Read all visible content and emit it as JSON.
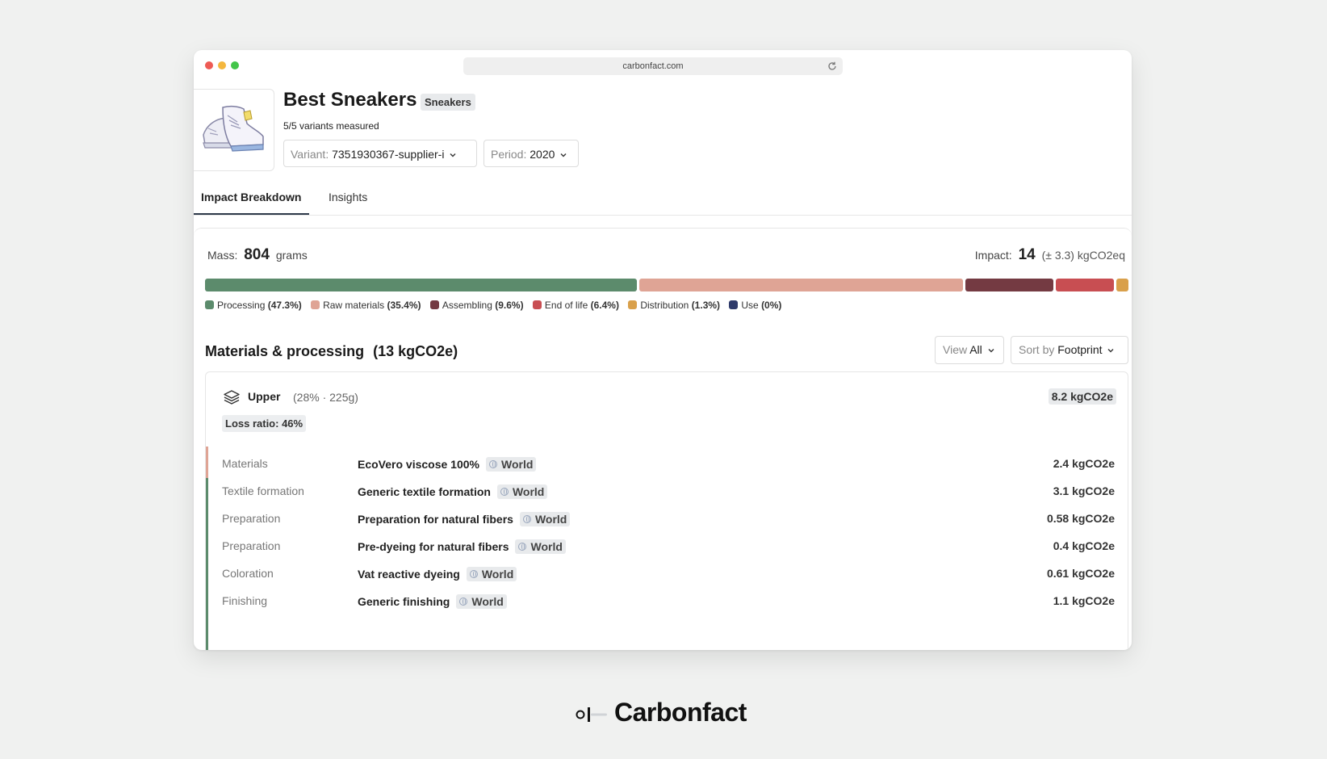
{
  "browser": {
    "url": "carbonfact.com"
  },
  "product": {
    "name": "Best Sneakers",
    "category": "Sneakers",
    "variants_measured": "5/5 variants measured",
    "variant_label": "Variant:",
    "variant_value": "7351930367-supplier-i",
    "period_label": "Period:",
    "period_value": "2020"
  },
  "tabs": [
    {
      "label": "Impact Breakdown",
      "active": true
    },
    {
      "label": "Insights",
      "active": false
    }
  ],
  "summary": {
    "mass_label": "Mass:",
    "mass_value": "804",
    "mass_unit": "grams",
    "impact_label": "Impact:",
    "impact_value": "14",
    "impact_range": "(± 3.3) kgCO2eq"
  },
  "breakdown": [
    {
      "name": "Processing",
      "pct_label": "(47.3%)",
      "pct": 47.3,
      "color": "#5c8b6c"
    },
    {
      "name": "Raw materials",
      "pct_label": "(35.4%)",
      "pct": 35.4,
      "color": "#dfa495"
    },
    {
      "name": "Assembling",
      "pct_label": "(9.6%)",
      "pct": 9.6,
      "color": "#743a42"
    },
    {
      "name": "End of life",
      "pct_label": "(6.4%)",
      "pct": 6.4,
      "color": "#c84e52"
    },
    {
      "name": "Distribution",
      "pct_label": "(1.3%)",
      "pct": 1.3,
      "color": "#d9a04b"
    },
    {
      "name": "Use",
      "pct_label": "(0%)",
      "pct": 0,
      "color": "#2e3a6a"
    }
  ],
  "materials_section": {
    "title": "Materials & processing",
    "total": "(13 kgCO2e)",
    "view_label": "View",
    "view_value": "All",
    "sort_label": "Sort by",
    "sort_value": "Footprint"
  },
  "component": {
    "name": "Upper",
    "meta": "(28% · 225g)",
    "total": "8.2 kgCO2e",
    "loss_ratio": "Loss ratio: 46%",
    "rows": [
      {
        "stage": "Materials",
        "process": "EcoVero viscose 100%",
        "location": "World",
        "value": "2.4 kgCO2e"
      },
      {
        "stage": "Textile formation",
        "process": "Generic textile formation",
        "location": "World",
        "value": "3.1 kgCO2e"
      },
      {
        "stage": "Preparation",
        "process": "Preparation for natural fibers",
        "location": "World",
        "value": "0.58 kgCO2e"
      },
      {
        "stage": "Preparation",
        "process": "Pre-dyeing for natural fibers",
        "location": "World",
        "value": "0.4 kgCO2e"
      },
      {
        "stage": "Coloration",
        "process": "Vat reactive dyeing",
        "location": "World",
        "value": "0.61 kgCO2e"
      },
      {
        "stage": "Finishing",
        "process": "Generic finishing",
        "location": "World",
        "value": "1.1 kgCO2e"
      }
    ]
  },
  "brand": {
    "name": "Carbonfact"
  }
}
